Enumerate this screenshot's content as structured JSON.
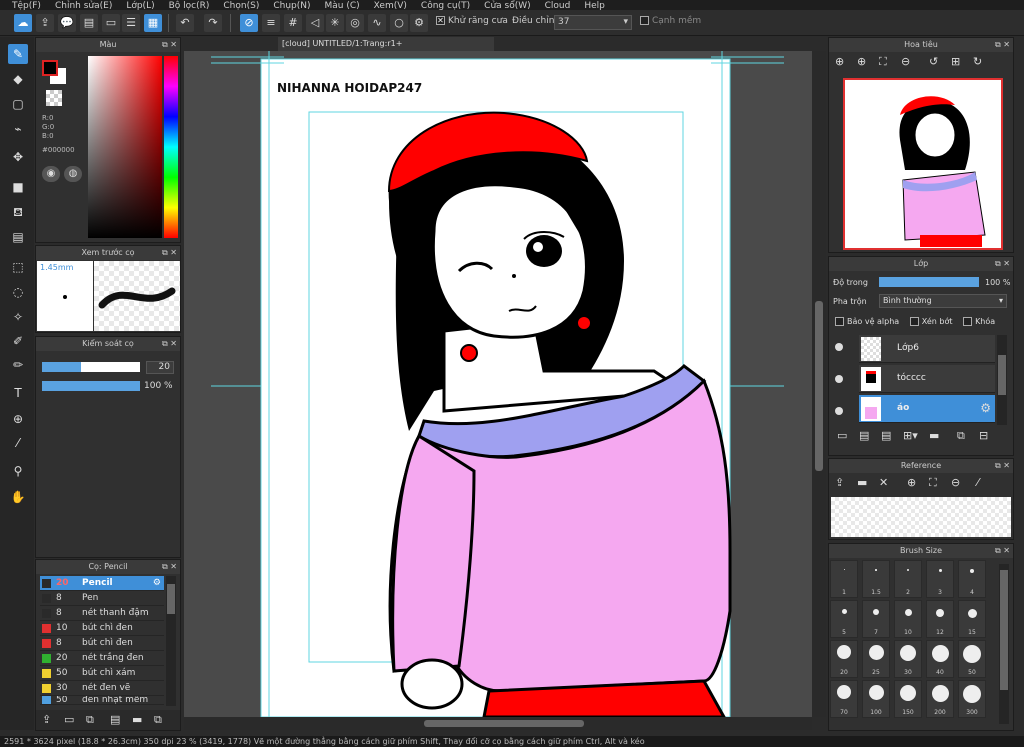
{
  "menu": [
    "Tệp(F)",
    "Chỉnh sửa(E)",
    "Lớp(L)",
    "Bộ lọc(R)",
    "Chọn(S)",
    "Chụp(N)",
    "Màu (C)",
    "Xem(V)",
    "Công cụ(T)",
    "Cửa sổ(W)",
    "Cloud",
    "Help"
  ],
  "toolbar": {
    "antialias_label": "Khử răng cưa",
    "adjust_label": "Điều chỉnh",
    "adjust_value": "37",
    "soft_label": "Cạnh mềm"
  },
  "color_panel": {
    "title": "Màu",
    "r": "R:0",
    "g": "G:0",
    "b": "B:0",
    "hex": "#000000"
  },
  "brush_preview": {
    "title": "Xem trước cọ",
    "size": "1.45mm"
  },
  "brush_control": {
    "title": "Kiểm soát cọ",
    "size_value": "20",
    "opacity_value": "100 %"
  },
  "brush_list": {
    "title": "Cọ: Pencil",
    "items": [
      {
        "size": "20",
        "name": "Pencil",
        "color": "#2a2a2a"
      },
      {
        "size": "8",
        "name": "Pen",
        "color": "#2a2a2a"
      },
      {
        "size": "8",
        "name": "nét thanh đậm",
        "color": "#2a2a2a"
      },
      {
        "size": "10",
        "name": "bút chì đen",
        "color": "#e03030"
      },
      {
        "size": "8",
        "name": "bút chì đen",
        "color": "#e03030"
      },
      {
        "size": "20",
        "name": "nét trắng đen",
        "color": "#30b030"
      },
      {
        "size": "50",
        "name": "bút chì xám",
        "color": "#f0d030"
      },
      {
        "size": "30",
        "name": "nét đen vẽ",
        "color": "#f0d030"
      },
      {
        "size": "50",
        "name": "đen nhạt mềm",
        "color": "#50a0e0"
      }
    ]
  },
  "document": {
    "tab": "[cloud] UNTITLED/1:Trang:r1+",
    "signature": "NIHANNA HOIDAP247"
  },
  "navigator": {
    "title": "Hoa tiêu"
  },
  "layers": {
    "title": "Lớp",
    "opacity_label": "Độ trong",
    "opacity_value": "100 %",
    "blend_label": "Pha trộn",
    "blend_value": "Bình thường",
    "protect_alpha": "Bảo vệ alpha",
    "clip": "Xén bớt",
    "lock": "Khóa",
    "items": [
      {
        "name": "Lớp6"
      },
      {
        "name": "tócccc"
      },
      {
        "name": "áo"
      }
    ]
  },
  "reference": {
    "title": "Reference"
  },
  "brush_size": {
    "title": "Brush Size",
    "sizes": [
      "1",
      "1.5",
      "2",
      "3",
      "4",
      "5",
      "7",
      "10",
      "12",
      "15",
      "20",
      "25",
      "30",
      "40",
      "50",
      "70",
      "100",
      "150",
      "200",
      "300"
    ]
  },
  "status": {
    "text": "2591 * 3624 pixel  (18.8 * 26.3cm)  350 dpi  23 %  (3419, 1778)  Vẽ một đường thẳng bằng cách giữ phím Shift, Thay đổi cỡ cọ bằng cách giữ phím Ctrl, Alt và kéo"
  },
  "colors": {
    "accent": "#3f8fd8",
    "primary_color": "#000000",
    "shirt": "#f5a8f0",
    "collar": "#9fa0f0",
    "red": "#ff0000"
  }
}
